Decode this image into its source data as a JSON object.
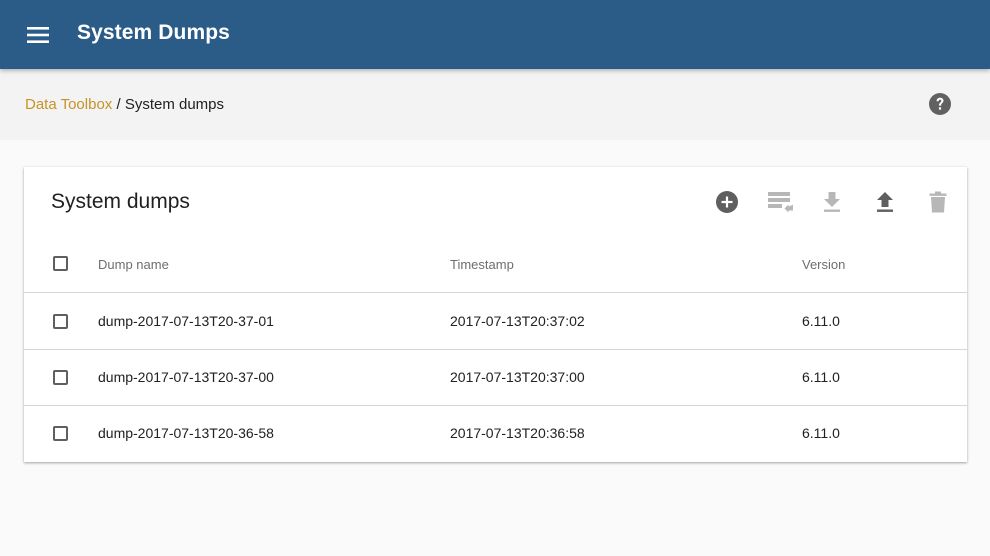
{
  "app_bar": {
    "title": "System Dumps"
  },
  "breadcrumb": {
    "parent": "Data Toolbox",
    "separator": " / ",
    "current": "System dumps"
  },
  "card": {
    "title": "System dumps",
    "toolbar": {
      "add": "add-circle-icon",
      "restore": "restore-dump-icon",
      "download": "download-icon",
      "upload": "upload-icon",
      "delete": "delete-icon"
    }
  },
  "table": {
    "headers": {
      "name": "Dump name",
      "timestamp": "Timestamp",
      "version": "Version"
    },
    "rows": [
      {
        "name": "dump-2017-07-13T20-37-01",
        "timestamp": "2017-07-13T20:37:02",
        "version": "6.11.0"
      },
      {
        "name": "dump-2017-07-13T20-37-00",
        "timestamp": "2017-07-13T20:37:00",
        "version": "6.11.0"
      },
      {
        "name": "dump-2017-07-13T20-36-58",
        "timestamp": "2017-07-13T20:36:58",
        "version": "6.11.0"
      }
    ]
  },
  "colors": {
    "app_bar": "#2b5c88",
    "link": "#c8922a",
    "icon_active": "#5f5f5f",
    "icon_disabled": "#b7b7b7"
  }
}
